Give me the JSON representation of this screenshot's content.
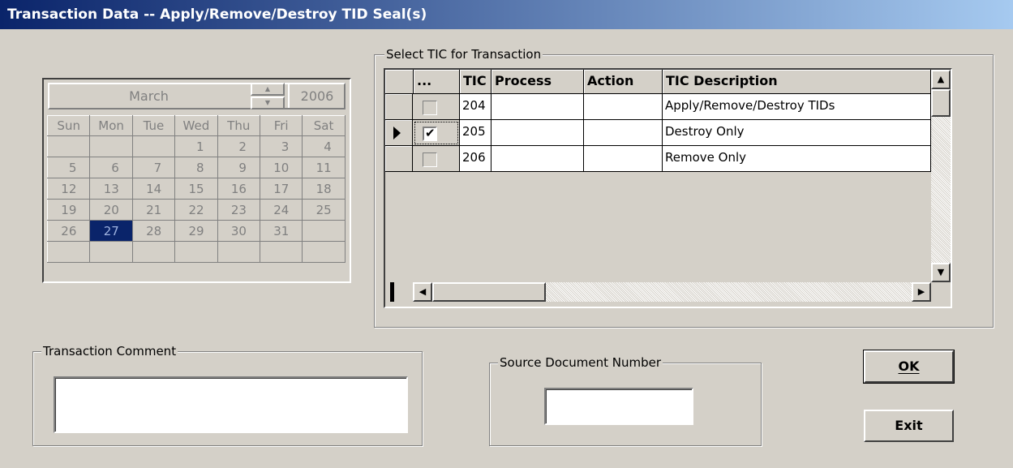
{
  "window": {
    "title": "Transaction Data -- Apply/Remove/Destroy TID Seal(s)"
  },
  "calendar": {
    "month": "March",
    "year": "2006",
    "spin_up": "▲",
    "spin_down": "▼",
    "weekdays": [
      "Sun",
      "Mon",
      "Tue",
      "Wed",
      "Thu",
      "Fri",
      "Sat"
    ],
    "weeks": [
      [
        "",
        "",
        "",
        "1",
        "2",
        "3",
        "4"
      ],
      [
        "5",
        "6",
        "7",
        "8",
        "9",
        "10",
        "11"
      ],
      [
        "12",
        "13",
        "14",
        "15",
        "16",
        "17",
        "18"
      ],
      [
        "19",
        "20",
        "21",
        "22",
        "23",
        "24",
        "25"
      ],
      [
        "26",
        "27",
        "28",
        "29",
        "30",
        "31",
        ""
      ],
      [
        "",
        "",
        "",
        "",
        "",
        "",
        ""
      ]
    ],
    "selected_day": "27"
  },
  "tic_group": {
    "caption": "Select TIC for Transaction",
    "columns": {
      "check": "...",
      "tic": "TIC",
      "process": "Process",
      "action": "Action",
      "description": "TIC Description"
    },
    "rows": [
      {
        "tic": "204",
        "process": "",
        "action": "",
        "description": "Apply/Remove/Destroy TIDs",
        "checked": false,
        "current": false
      },
      {
        "tic": "205",
        "process": "",
        "action": "",
        "description": "Destroy Only",
        "checked": true,
        "current": true
      },
      {
        "tic": "206",
        "process": "",
        "action": "",
        "description": "Remove Only",
        "checked": false,
        "current": false
      }
    ],
    "scroll_up": "▲",
    "scroll_down": "▼",
    "scroll_left": "◀",
    "scroll_right": "▶"
  },
  "comment_group": {
    "caption": "Transaction Comment",
    "value": ""
  },
  "source_group": {
    "caption": "Source Document Number",
    "value": ""
  },
  "buttons": {
    "ok": "OK",
    "exit": "Exit"
  }
}
